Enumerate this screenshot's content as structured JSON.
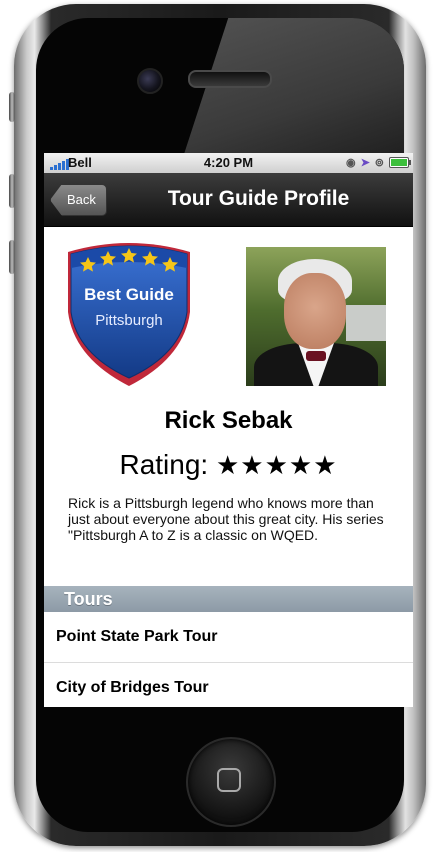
{
  "status_bar": {
    "carrier": "Bell",
    "time": "4:20 PM"
  },
  "nav": {
    "back_label": "Back",
    "title": "Tour Guide Profile"
  },
  "badge": {
    "line1": "Best Guide",
    "line2": "Pittsburgh",
    "stars": 5
  },
  "guide": {
    "name": "Rick Sebak",
    "rating_label": "Rating:",
    "rating_stars": "★★★★★",
    "rating_value": 5,
    "bio": "Rick is a Pittsburgh legend who knows more than just about everyone about this great city. His series \"Pittsburgh A to Z is a classic on WQED."
  },
  "tours": {
    "header": "Tours",
    "items": [
      {
        "label": "Point State Park Tour"
      },
      {
        "label": "City of Bridges Tour"
      }
    ]
  },
  "colors": {
    "badge_blue": "#1d4fa3",
    "badge_red": "#c0283a",
    "badge_star": "#f5c518",
    "nav_bar": "#111111",
    "section_header": "#9aa6b1"
  }
}
